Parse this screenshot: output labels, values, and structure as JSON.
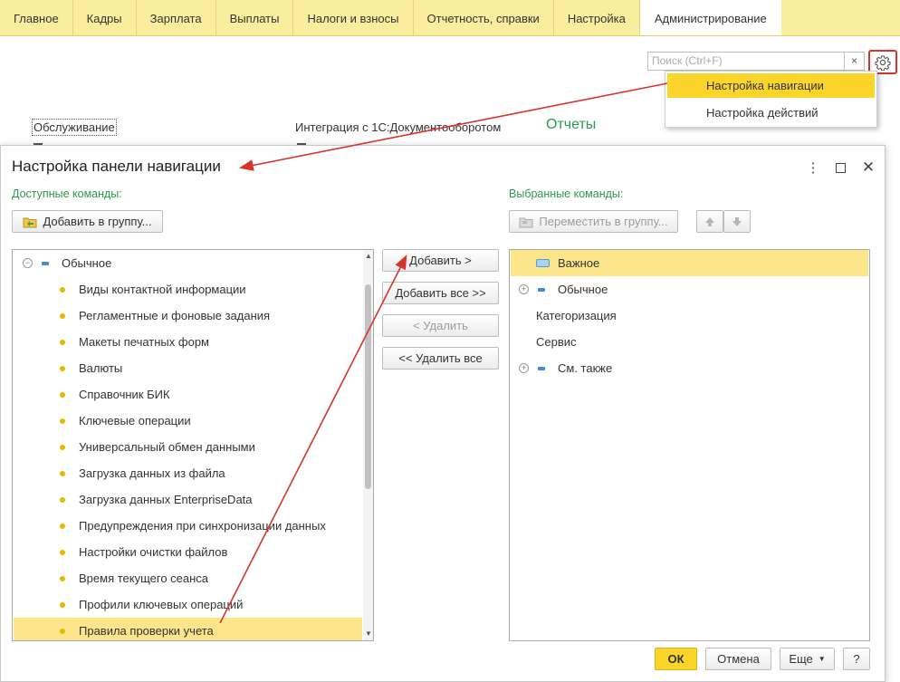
{
  "menu": {
    "tabs": [
      "Главное",
      "Кадры",
      "Зарплата",
      "Выплаты",
      "Налоги и взносы",
      "Отчетность, справки",
      "Настройка",
      "Администрирование"
    ],
    "active_tab": "Администрирование"
  },
  "search": {
    "placeholder": "Поиск (Ctrl+F)",
    "clear": "×"
  },
  "settings_menu": {
    "items": [
      "Настройка навигации",
      "Настройка действий"
    ],
    "highlighted": "Настройка навигации"
  },
  "background": {
    "service": "Обслуживание",
    "integration": "Интеграция с 1С:Документооборотом",
    "reports": "Отчеты"
  },
  "dialog": {
    "title": "Настройка панели навигации",
    "available_label": "Доступные команды:",
    "selected_label": "Выбранные команды:",
    "add_to_group": "Добавить в группу...",
    "move_to_group": "Переместить в группу...",
    "available_tree": {
      "group": "Обычное",
      "items": [
        "Виды контактной информации",
        "Регламентные и фоновые задания",
        "Макеты печатных форм",
        "Валюты",
        "Справочник БИК",
        "Ключевые операции",
        "Универсальный обмен данными",
        "Загрузка данных из файла",
        "Загрузка данных EnterpriseData",
        "Предупреждения при синхронизации данных",
        "Настройки очистки файлов",
        "Время текущего сеанса",
        "Профили ключевых операций",
        "Правила проверки учета"
      ],
      "selected_item": "Правила проверки учета"
    },
    "middle_buttons": {
      "add": "Добавить >",
      "add_all": "Добавить все >>",
      "remove": "< Удалить",
      "remove_all": "<< Удалить все"
    },
    "selected_tree": [
      {
        "label": "Важное",
        "type": "group-important"
      },
      {
        "label": "Обычное",
        "type": "group"
      },
      {
        "label": "Категоризация",
        "type": "plain"
      },
      {
        "label": "Сервис",
        "type": "plain"
      },
      {
        "label": "См. также",
        "type": "group"
      }
    ],
    "footer": {
      "ok": "ОК",
      "cancel": "Отмена",
      "more": "Еще",
      "help": "?"
    }
  },
  "colors": {
    "menu_bg": "#fbed9e",
    "highlight": "#fbd529",
    "selection": "#fce58a",
    "accent_green": "#2b9a4a",
    "annotation_red": "#d9342b"
  }
}
